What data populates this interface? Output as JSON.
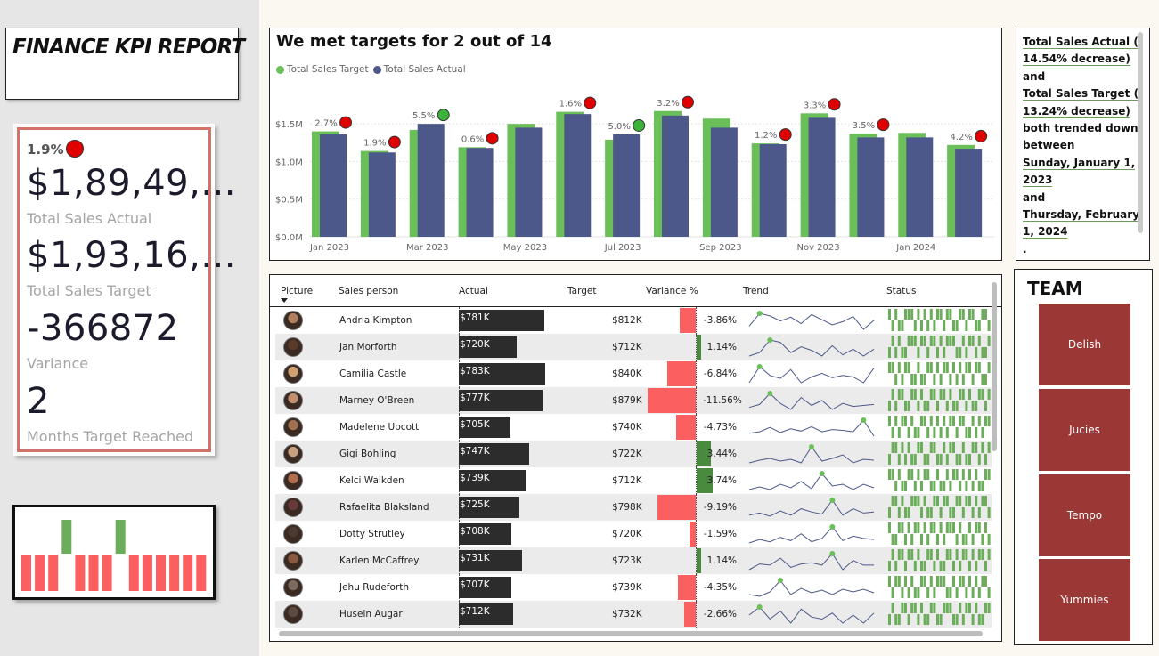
{
  "report_title": "FINANCE KPI REPORT",
  "kpi": {
    "delta_pct": "1.9%",
    "status_color": "#e10000",
    "total_sales_actual_value": "$1,89,49,...",
    "total_sales_actual_label": "Total Sales Actual",
    "total_sales_target_value": "$1,93,16,...",
    "total_sales_target_label": "Total Sales Target",
    "variance_value": "-366872",
    "variance_label": "Variance",
    "months_target_reached_value": "2",
    "months_target_reached_label": "Months Target Reached"
  },
  "status_strip": {
    "met_color": "#6bad5a",
    "missed_color": "#fb5f5f",
    "months_met": [
      false,
      false,
      false,
      true,
      false,
      false,
      false,
      true,
      false,
      false,
      false,
      false,
      false,
      false
    ]
  },
  "chart": {
    "title": "We met targets for 2 out of 14",
    "legend": [
      {
        "name": "Total Sales Target",
        "color": "#6bbf59"
      },
      {
        "name": "Total Sales Actual",
        "color": "#4c5889"
      }
    ],
    "ytick_labels": [
      "$0.0M",
      "$0.5M",
      "$1.0M",
      "$1.5M"
    ],
    "xtick_labels": [
      "Jan 2023",
      "Mar 2023",
      "May 2023",
      "Jul 2023",
      "Sep 2023",
      "Nov 2023",
      "Jan 2024"
    ]
  },
  "chart_data": {
    "type": "bar",
    "title": "We met targets for 2 out of 14",
    "categories": [
      "Jan 2023",
      "Feb 2023",
      "Mar 2023",
      "Apr 2023",
      "May 2023",
      "Jun 2023",
      "Jul 2023",
      "Aug 2023",
      "Sep 2023",
      "Oct 2023",
      "Nov 2023",
      "Dec 2023",
      "Jan 2024",
      "Feb 2024"
    ],
    "series": [
      {
        "name": "Total Sales Target",
        "values": [
          1.4,
          1.14,
          1.42,
          1.19,
          1.5,
          1.66,
          1.29,
          1.67,
          1.57,
          1.24,
          1.64,
          1.37,
          1.38,
          1.22
        ]
      },
      {
        "name": "Total Sales Actual",
        "values": [
          1.36,
          1.12,
          1.5,
          1.18,
          1.45,
          1.63,
          1.36,
          1.61,
          1.45,
          1.23,
          1.58,
          1.32,
          1.32,
          1.17
        ]
      }
    ],
    "labels": [
      "2.7%",
      "1.9%",
      "5.5%",
      "0.6%",
      "",
      "1.6%",
      "5.0%",
      "3.2%",
      "",
      "1.2%",
      "3.3%",
      "3.5%",
      "",
      "4.2%"
    ],
    "status": [
      "miss",
      "miss",
      "met",
      "miss",
      "",
      "miss",
      "met",
      "miss",
      "",
      "miss",
      "miss",
      "miss",
      "",
      "miss"
    ],
    "ylim": [
      0,
      1.75
    ],
    "yunit": "$M",
    "grid": true,
    "legend_position": "top-left"
  },
  "table": {
    "columns": [
      "Picture",
      "Sales person",
      "Actual",
      "Target",
      "Variance %",
      "Trend",
      "Status"
    ],
    "rows": [
      {
        "name": "Andria Kimpton",
        "actual": "$781K",
        "actual_k": 781,
        "target": "$812K",
        "variance": "-3.86%",
        "variance_pct": -3.86,
        "trend": [
          3,
          5,
          4.6,
          3.8,
          4.4,
          3.4,
          4.8,
          4,
          3.2,
          3.7,
          4.5,
          2.5,
          3.9
        ],
        "status": [
          1,
          0,
          1,
          0,
          0,
          1,
          1,
          1,
          0,
          1,
          0,
          1,
          0,
          1,
          0,
          1,
          1,
          0,
          1,
          1,
          0,
          0,
          1,
          1,
          0,
          1,
          1,
          0,
          0,
          1,
          1,
          0
        ]
      },
      {
        "name": "Jan Morforth",
        "actual": "$720K",
        "actual_k": 720,
        "target": "$712K",
        "variance": "1.14%",
        "variance_pct": 1.14,
        "trend": [
          3,
          3.3,
          4.4,
          4.2,
          3.3,
          3.8,
          3.5,
          3,
          3.9,
          3.1,
          3.6,
          3.0,
          3.6
        ],
        "status": [
          0,
          1,
          0,
          1,
          0,
          0,
          1,
          1,
          1,
          0,
          1,
          1,
          0,
          1,
          1,
          0,
          1,
          0,
          1,
          1,
          1,
          0,
          0,
          1,
          0,
          1,
          1,
          0,
          1,
          0,
          0,
          1
        ]
      },
      {
        "name": "Camilia Castle",
        "actual": "$783K",
        "actual_k": 783,
        "target": "$840K",
        "variance": "-6.84%",
        "variance_pct": -6.84,
        "trend": [
          2.6,
          4.8,
          3.6,
          3.2,
          4.4,
          2.6,
          3.4,
          3.9,
          3.3,
          3.6,
          3.4,
          2.6,
          4.6
        ],
        "status": [
          1,
          1,
          0,
          1,
          0,
          1,
          1,
          0,
          0,
          1,
          0,
          0,
          1,
          1,
          0,
          1,
          0,
          1,
          1,
          0,
          1,
          0,
          1,
          0,
          1,
          1,
          0,
          1,
          1,
          0,
          0,
          1
        ]
      },
      {
        "name": "Marney O'Breen",
        "actual": "$777K",
        "actual_k": 777,
        "target": "$879K",
        "variance": "-11.56%",
        "variance_pct": -11.56,
        "trend": [
          3.2,
          3.5,
          4.6,
          3.6,
          3.0,
          4.2,
          3.4,
          3.9,
          3.0,
          3.6,
          3.3,
          3.4,
          3.5
        ],
        "status": [
          0,
          1,
          0,
          1,
          1,
          0,
          0,
          1,
          1,
          0,
          1,
          0,
          0,
          1,
          1,
          0,
          1,
          1,
          0,
          1,
          0,
          0,
          1,
          1,
          0,
          1,
          0,
          0,
          1,
          1,
          0,
          1
        ]
      },
      {
        "name": "Madelene Upcott",
        "actual": "$705K",
        "actual_k": 705,
        "target": "$740K",
        "variance": "-4.73%",
        "variance_pct": -4.73,
        "trend": [
          3,
          3.2,
          3.8,
          3.1,
          3.6,
          3.3,
          3.9,
          3.2,
          3.5,
          3.4,
          3.2,
          4.8,
          2.6
        ],
        "status": [
          1,
          0,
          1,
          0,
          1,
          1,
          0,
          1,
          0,
          0,
          1,
          1,
          0,
          1,
          0,
          1,
          0,
          1,
          0,
          1,
          1,
          0,
          1,
          1,
          0,
          0,
          1,
          0,
          1,
          0,
          1,
          1
        ]
      },
      {
        "name": "Gigi Bohling",
        "actual": "$747K",
        "actual_k": 747,
        "target": "$722K",
        "variance": "3.44%",
        "variance_pct": 3.44,
        "trend": [
          3,
          3.3,
          3.5,
          3.2,
          3.4,
          3.0,
          4.8,
          3.2,
          3.5,
          3.9,
          3.0,
          3.4,
          3.3
        ],
        "status": [
          0,
          1,
          1,
          0,
          1,
          0,
          1,
          0,
          0,
          1,
          1,
          0,
          0,
          1,
          1,
          0,
          0,
          1,
          0,
          1,
          1,
          0,
          0,
          1,
          0,
          0,
          1,
          1,
          0,
          1,
          0,
          1
        ]
      },
      {
        "name": "Kelci Walkden",
        "actual": "$739K",
        "actual_k": 739,
        "target": "$712K",
        "variance": "3.74%",
        "variance_pct": 3.74,
        "trend": [
          3,
          3.3,
          3.0,
          3.6,
          3.2,
          3.9,
          3.1,
          4.8,
          3.4,
          3.6,
          3.0,
          3.6,
          3.2
        ],
        "status": [
          1,
          1,
          0,
          1,
          0,
          0,
          1,
          1,
          0,
          1,
          0,
          1,
          1,
          0,
          0,
          1,
          0,
          0,
          1,
          0,
          1,
          1,
          0,
          1,
          0,
          1,
          0,
          1,
          0,
          0,
          1,
          1
        ]
      },
      {
        "name": "Rafaelita Blaksland",
        "actual": "$725K",
        "actual_k": 725,
        "target": "$798K",
        "variance": "-9.19%",
        "variance_pct": -9.19,
        "trend": [
          3,
          3.2,
          2.9,
          3.4,
          3.0,
          3.6,
          3.3,
          3.1,
          4.4,
          3.0,
          3.6,
          3.2,
          3.3
        ],
        "status": [
          0,
          1,
          1,
          0,
          1,
          0,
          0,
          1,
          1,
          1,
          0,
          1,
          0,
          0,
          1,
          1,
          0,
          1,
          1,
          0,
          0,
          1,
          1,
          0,
          1,
          1,
          0,
          1,
          0,
          1,
          1,
          0
        ]
      },
      {
        "name": "Dotty Strutley",
        "actual": "$708K",
        "actual_k": 708,
        "target": "$720K",
        "variance": "-1.59%",
        "variance_pct": -1.59,
        "trend": [
          3,
          3.3,
          3.1,
          3.5,
          3.2,
          3.8,
          3.1,
          3.4,
          4.4,
          3.2,
          3.6,
          3.4,
          3.3
        ],
        "status": [
          1,
          0,
          0,
          1,
          1,
          0,
          1,
          0,
          1,
          1,
          0,
          1,
          0,
          1,
          1,
          0,
          1,
          0,
          1,
          1,
          1,
          0,
          1,
          0,
          0,
          1,
          0,
          1,
          1,
          0,
          1,
          0
        ]
      },
      {
        "name": "Karlen McCaffrey",
        "actual": "$731K",
        "actual_k": 731,
        "target": "$723K",
        "variance": "1.14%",
        "variance_pct": 1.14,
        "trend": [
          3,
          3.5,
          3.4,
          4.0,
          3.2,
          3.5,
          3.6,
          3.4,
          4.4,
          3.0,
          3.8,
          3.4,
          3.4
        ],
        "status": [
          0,
          1,
          0,
          1,
          1,
          0,
          1,
          1,
          0,
          1,
          0,
          0,
          1,
          1,
          0,
          1,
          0,
          0,
          1,
          1,
          0,
          1,
          0,
          1,
          1,
          0,
          1,
          0,
          1,
          1,
          0,
          1
        ]
      },
      {
        "name": "Jehu Rudeforth",
        "actual": "$707K",
        "actual_k": 707,
        "target": "$739K",
        "variance": "-4.35%",
        "variance_pct": -4.35,
        "trend": [
          3,
          2.8,
          3.3,
          4.6,
          3.0,
          3.7,
          3.2,
          3.5,
          3.0,
          3.6,
          3.3,
          3.6,
          3.2
        ],
        "status": [
          1,
          0,
          1,
          1,
          0,
          1,
          0,
          1,
          0,
          0,
          1,
          1,
          0,
          1,
          0,
          1,
          1,
          1,
          0,
          0,
          1,
          0,
          1,
          1,
          0,
          1,
          0,
          1,
          0,
          1,
          1,
          0
        ]
      },
      {
        "name": "Husein Augar",
        "actual": "$712K",
        "actual_k": 712,
        "target": "$732K",
        "variance": "-2.66%",
        "variance_pct": -2.66,
        "trend": [
          3.2,
          3.6,
          3.0,
          3.4,
          2.8,
          3.5,
          3.1,
          3.0,
          3.3,
          2.8,
          3.2,
          2.8,
          3.3
        ],
        "status": [
          0,
          1,
          0,
          0,
          1,
          1,
          0,
          1,
          1,
          0,
          1,
          0,
          0,
          1,
          1,
          0,
          0,
          1,
          1,
          1,
          0,
          0,
          1,
          0,
          1,
          1,
          0,
          1,
          0,
          0,
          1,
          1
        ]
      }
    ]
  },
  "summary": {
    "line1": "Total Sales Actual (",
    "line2": "14.54% decrease)",
    "line3": "and",
    "line4": "Total Sales Target (",
    "line5": "13.24% decrease)",
    "line6": "both trended down between",
    "line7": "Sunday, January 1, 2023",
    "line8": "and",
    "line9": "Thursday, February 1, 2024",
    "line10": "."
  },
  "team": {
    "title": "TEAM",
    "buttons": [
      "Delish",
      "Jucies",
      "Tempo",
      "Yummies"
    ],
    "button_color": "#9b3735"
  }
}
